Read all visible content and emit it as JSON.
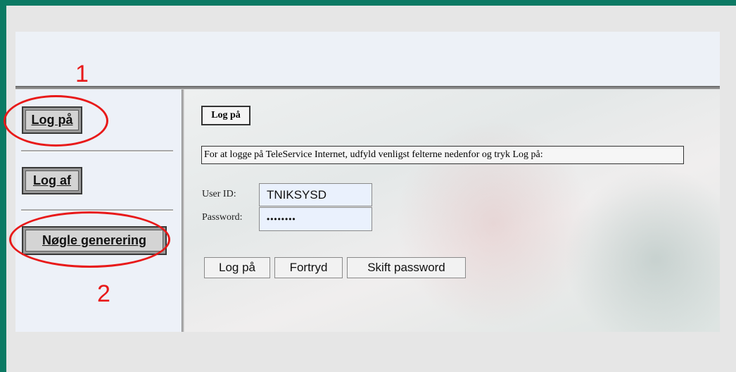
{
  "sidebar": {
    "login_label": "Log på",
    "logout_label": "Log af",
    "keygen_label": "Nøgle generering"
  },
  "annotations": {
    "one": "1",
    "two": "2"
  },
  "main": {
    "title": "Log på",
    "instruction": "For at logge på TeleService Internet, udfyld venligst felterne nedenfor og tryk Log på:",
    "userid_label": "User ID:",
    "userid_value": "TNIKSYSD",
    "password_label": "Password:",
    "password_value": "••••••••",
    "buttons": {
      "login": "Log på",
      "cancel": "Fortryd",
      "change_password": "Skift password"
    }
  },
  "colors": {
    "window_border": "#0c7a64",
    "annotation": "#e81919",
    "input_bg": "#eaf1fd"
  }
}
